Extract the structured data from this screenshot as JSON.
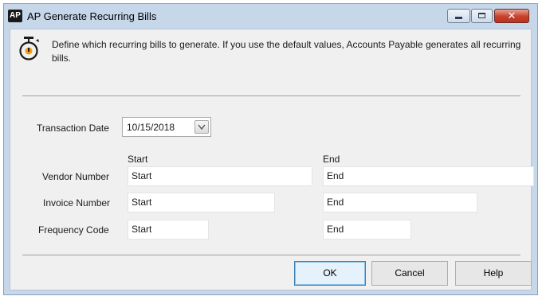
{
  "window": {
    "app_badge": "AP",
    "title": "AP Generate Recurring Bills",
    "controls": {
      "minimize_icon": "minimize-icon",
      "maximize_icon": "maximize-icon",
      "close_icon": "close-icon",
      "close_glyph": "✕"
    }
  },
  "info": {
    "icon": "timer-icon",
    "text": "Define which recurring bills to generate. If you use the default values, Accounts Payable generates all recurring bills."
  },
  "transaction_date": {
    "label": "Transaction Date",
    "value": "10/15/2018",
    "dropdown_icon": "chevron-down-icon"
  },
  "range_headers": {
    "start": "Start",
    "end": "End"
  },
  "ranges": [
    {
      "label": "Vendor Number",
      "start": "Start",
      "end": "End"
    },
    {
      "label": "Invoice Number",
      "start": "Start",
      "end": "End"
    },
    {
      "label": "Frequency Code",
      "start": "Start",
      "end": "End"
    }
  ],
  "buttons": {
    "ok": "OK",
    "cancel": "Cancel",
    "help": "Help"
  },
  "colors": {
    "title_bar": "#c6d7ea",
    "close_button": "#c7402a",
    "default_button_border": "#3c7fb1"
  }
}
